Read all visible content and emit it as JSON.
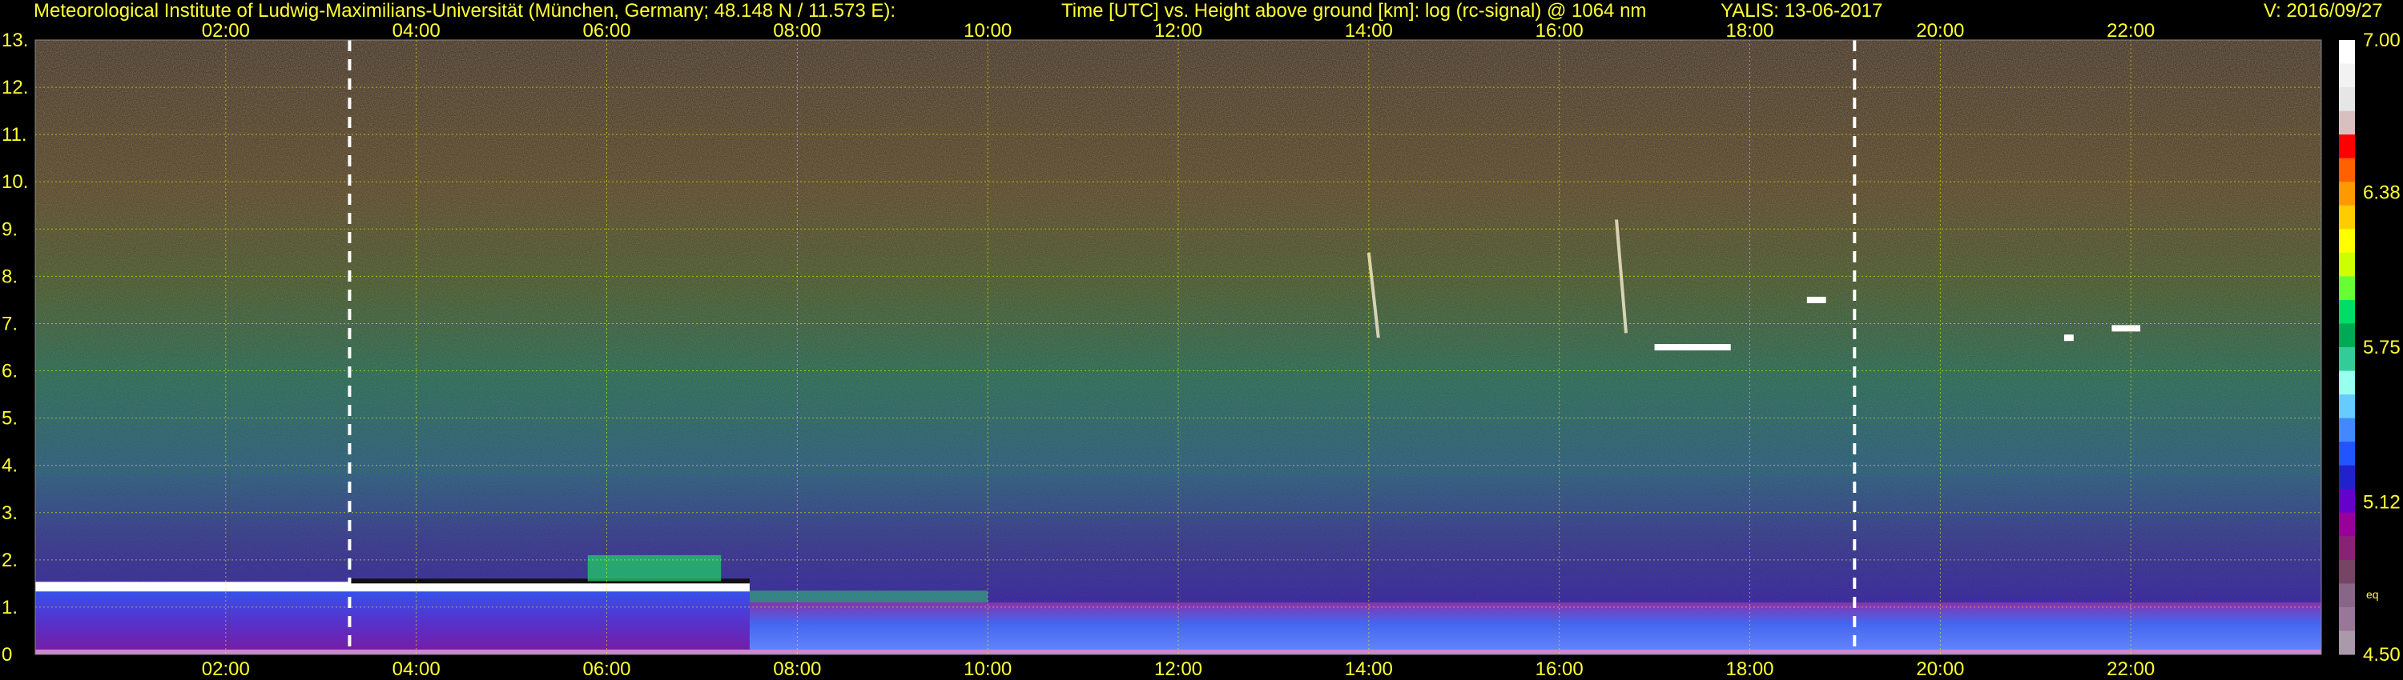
{
  "header": {
    "institute": "Meteorological Institute of Ludwig-Maximilians-Universität (München, Germany; 48.148 N / 11.573 E):",
    "title": "Time [UTC] vs. Height above ground [km]: log (rc-signal) @ 1064 nm",
    "instrument_date": "YALIS: 13-06-2017",
    "version": "V: 2016/09/27"
  },
  "chart_data": {
    "type": "heatmap",
    "title": "Time [UTC] vs. Height above ground [km]: log (rc-signal) @ 1064 nm",
    "xlabel": "Time [UTC]",
    "ylabel": "Height above ground [km]",
    "x_range_hours": [
      0,
      24
    ],
    "x_ticks": [
      "02:00",
      "04:00",
      "06:00",
      "08:00",
      "10:00",
      "12:00",
      "14:00",
      "16:00",
      "18:00",
      "20:00",
      "22:00"
    ],
    "x_tick_hours": [
      2,
      4,
      6,
      8,
      10,
      12,
      14,
      16,
      18,
      20,
      22
    ],
    "ylim": [
      0,
      13
    ],
    "y_ticks": [
      "0",
      "1.",
      "2.",
      "3.",
      "4.",
      "5.",
      "6.",
      "7.",
      "8.",
      "9.",
      "10.",
      "11.",
      "12.",
      "13."
    ],
    "y_tick_values": [
      0,
      1,
      2,
      3,
      4,
      5,
      6,
      7,
      8,
      9,
      10,
      11,
      12,
      13
    ],
    "grid": true,
    "grid_color": "#ffff00",
    "markers": [
      {
        "hour": 3.3,
        "style": "dashed",
        "color": "#ffffff"
      },
      {
        "hour": 19.1,
        "style": "dashed",
        "color": "#ffffff"
      }
    ],
    "colorbar": {
      "range": [
        4.5,
        7.0
      ],
      "labels": [
        "7.00",
        "6.38",
        "5.75",
        "5.12",
        "4.50"
      ],
      "label_values": [
        7.0,
        6.38,
        5.75,
        5.12,
        4.5
      ],
      "note": "eq",
      "colors": [
        "#ffffff",
        "#f2f2f2",
        "#e6e6e6",
        "#d9c0c0",
        "#ff0000",
        "#ff6000",
        "#ff9900",
        "#ffcc00",
        "#ffff00",
        "#ccff00",
        "#66ff33",
        "#00dd66",
        "#00aa55",
        "#33cc99",
        "#99ffee",
        "#66ccff",
        "#4488ff",
        "#2255ff",
        "#2222cc",
        "#6600cc",
        "#990099",
        "#882277",
        "#774466",
        "#886688",
        "#997799",
        "#aa99aa"
      ]
    },
    "features": {
      "boundary_layer_top_km": 1.4,
      "boundary_layer_period_hours": [
        0,
        7.5
      ],
      "clouds": [
        {
          "hour_start": 17.0,
          "hour_end": 17.8,
          "height_km": 6.5
        },
        {
          "hour_start": 18.6,
          "hour_end": 18.8,
          "height_km": 7.5
        },
        {
          "hour_start": 21.3,
          "hour_end": 21.4,
          "height_km": 6.7
        },
        {
          "hour_start": 21.8,
          "hour_end": 22.1,
          "height_km": 6.9
        }
      ],
      "fall_streaks": [
        {
          "hour": 14.0,
          "height_range_km": [
            6.7,
            8.5
          ]
        },
        {
          "hour": 16.6,
          "height_range_km": [
            6.8,
            9.2
          ]
        }
      ]
    }
  }
}
